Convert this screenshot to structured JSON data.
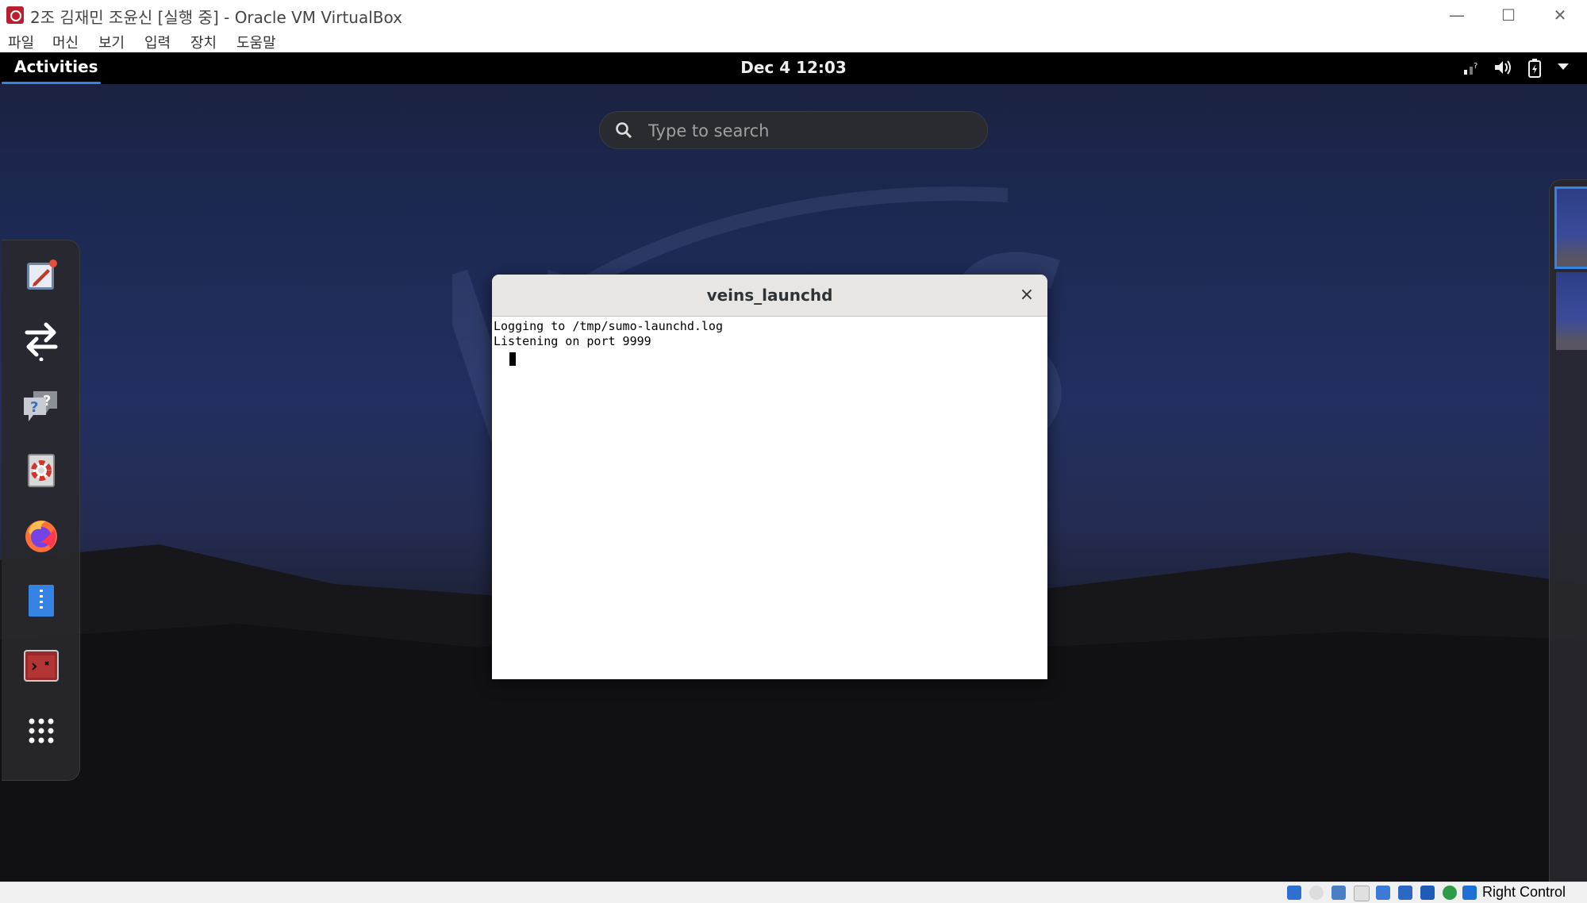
{
  "host_window": {
    "title": "2조 김재민 조윤신 [실행 중] - Oracle VM VirtualBox",
    "minimize_glyph": "—",
    "maximize_glyph": "☐",
    "close_glyph": "✕"
  },
  "host_menu": [
    "파일",
    "머신",
    "보기",
    "입력",
    "장치",
    "도움말"
  ],
  "gnome": {
    "activities_label": "Activities",
    "clock": "Dec 4  12:03",
    "tray_icons": [
      "network-icon",
      "volume-icon",
      "battery-icon",
      "menu-arrow-icon"
    ]
  },
  "search": {
    "placeholder": "Type to search"
  },
  "dock": {
    "apps": [
      "text-editor",
      "transfer",
      "help-chat",
      "help-lifebuoy",
      "firefox",
      "document",
      "terminal",
      "show-apps"
    ]
  },
  "terminal": {
    "title": "veins_launchd",
    "close_glyph": "×",
    "lines": [
      "Logging to /tmp/sumo-launchd.log",
      "Listening on port 9999"
    ]
  },
  "status_bar": {
    "host_key": "Right Control"
  },
  "colors": {
    "accent": "#3584e4",
    "vbox_icon": "#b8202d",
    "firefox": "#ff7139"
  }
}
